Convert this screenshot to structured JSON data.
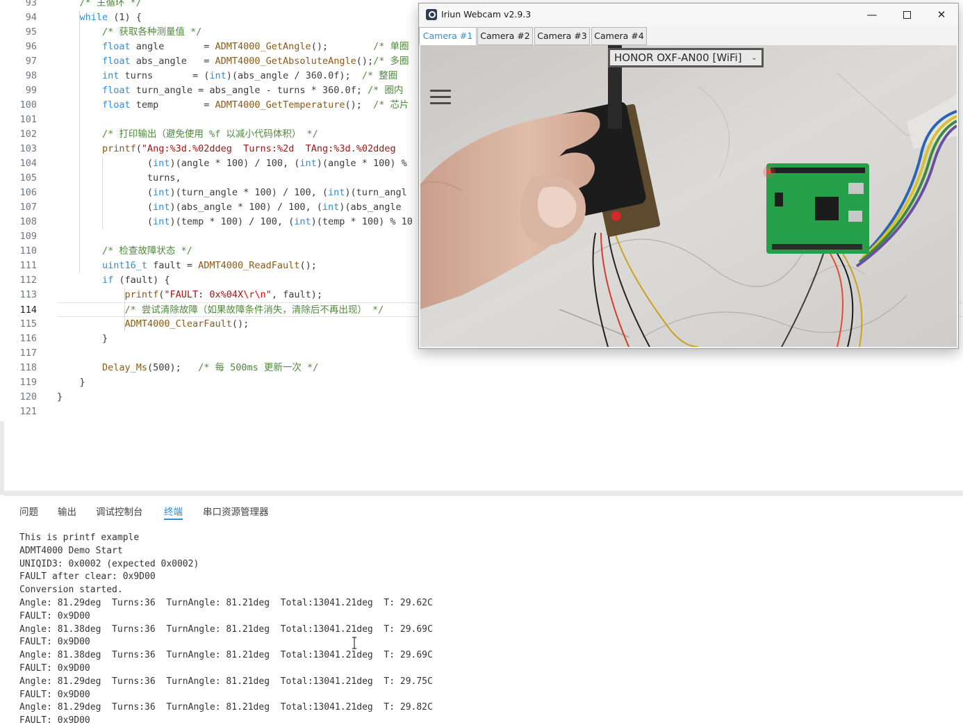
{
  "editor": {
    "lines": [
      {
        "n": "93",
        "indent": 4,
        "tokens": [
          [
            "cm",
            "/* 主循环 */"
          ]
        ]
      },
      {
        "n": "94",
        "indent": 4,
        "tokens": [
          [
            "kw",
            "while"
          ],
          [
            "pl",
            " (1) {"
          ]
        ]
      },
      {
        "n": "95",
        "indent": 8,
        "tokens": [
          [
            "cm",
            "/* 获取各种测量值 */"
          ]
        ]
      },
      {
        "n": "96",
        "indent": 8,
        "tokens": [
          [
            "type",
            "float"
          ],
          [
            "pl",
            " angle       = "
          ],
          [
            "fn",
            "ADMT4000_GetAngle"
          ],
          [
            "pl",
            "();        "
          ],
          [
            "cm",
            "/* 单圈"
          ]
        ]
      },
      {
        "n": "97",
        "indent": 8,
        "tokens": [
          [
            "type",
            "float"
          ],
          [
            "pl",
            " abs_angle   = "
          ],
          [
            "fn",
            "ADMT4000_GetAbsoluteAngle"
          ],
          [
            "pl",
            "();"
          ],
          [
            "cm",
            "/* 多圈"
          ]
        ]
      },
      {
        "n": "98",
        "indent": 8,
        "tokens": [
          [
            "type",
            "int"
          ],
          [
            "pl",
            " turns       = ("
          ],
          [
            "type",
            "int"
          ],
          [
            "pl",
            ")(abs_angle / 360.0f);  "
          ],
          [
            "cm",
            "/* 整圈"
          ]
        ]
      },
      {
        "n": "99",
        "indent": 8,
        "tokens": [
          [
            "type",
            "float"
          ],
          [
            "pl",
            " turn_angle = abs_angle - turns * 360.0f; "
          ],
          [
            "cm",
            "/* 圈内"
          ]
        ]
      },
      {
        "n": "100",
        "indent": 8,
        "tokens": [
          [
            "type",
            "float"
          ],
          [
            "pl",
            " temp        = "
          ],
          [
            "fn",
            "ADMT4000_GetTemperature"
          ],
          [
            "pl",
            "();  "
          ],
          [
            "cm",
            "/* 芯片"
          ]
        ]
      },
      {
        "n": "101",
        "indent": 0,
        "tokens": []
      },
      {
        "n": "102",
        "indent": 8,
        "tokens": [
          [
            "cm",
            "/* 打印输出（避免使用 %f 以减小代码体积） */"
          ]
        ]
      },
      {
        "n": "103",
        "indent": 8,
        "tokens": [
          [
            "fn",
            "printf"
          ],
          [
            "pl",
            "("
          ],
          [
            "str",
            "\"Ang:%3d.%02ddeg  Turns:%2d  TAng:%3d.%02ddeg"
          ]
        ]
      },
      {
        "n": "104",
        "indent": 16,
        "tokens": [
          [
            "pl",
            "("
          ],
          [
            "type",
            "int"
          ],
          [
            "pl",
            ")(angle * 100) / 100, ("
          ],
          [
            "type",
            "int"
          ],
          [
            "pl",
            ")(angle * 100) %"
          ]
        ]
      },
      {
        "n": "105",
        "indent": 16,
        "tokens": [
          [
            "pl",
            "turns,"
          ]
        ]
      },
      {
        "n": "106",
        "indent": 16,
        "tokens": [
          [
            "pl",
            "("
          ],
          [
            "type",
            "int"
          ],
          [
            "pl",
            ")(turn_angle * 100) / 100, ("
          ],
          [
            "type",
            "int"
          ],
          [
            "pl",
            ")(turn_angl"
          ]
        ]
      },
      {
        "n": "107",
        "indent": 16,
        "tokens": [
          [
            "pl",
            "("
          ],
          [
            "type",
            "int"
          ],
          [
            "pl",
            ")(abs_angle * 100) / 100, ("
          ],
          [
            "type",
            "int"
          ],
          [
            "pl",
            ")(abs_angle "
          ]
        ]
      },
      {
        "n": "108",
        "indent": 16,
        "tokens": [
          [
            "pl",
            "("
          ],
          [
            "type",
            "int"
          ],
          [
            "pl",
            ")(temp * 100) / 100, ("
          ],
          [
            "type",
            "int"
          ],
          [
            "pl",
            ")(temp * 100) % 10"
          ]
        ]
      },
      {
        "n": "109",
        "indent": 0,
        "tokens": []
      },
      {
        "n": "110",
        "indent": 8,
        "tokens": [
          [
            "cm",
            "/* 检查故障状态 */"
          ]
        ]
      },
      {
        "n": "111",
        "indent": 8,
        "tokens": [
          [
            "type",
            "uint16_t"
          ],
          [
            "pl",
            " fault = "
          ],
          [
            "fn",
            "ADMT4000_ReadFault"
          ],
          [
            "pl",
            "();"
          ]
        ]
      },
      {
        "n": "112",
        "indent": 8,
        "tokens": [
          [
            "kw",
            "if"
          ],
          [
            "pl",
            " (fault) {"
          ]
        ]
      },
      {
        "n": "113",
        "indent": 12,
        "tokens": [
          [
            "fn",
            "printf"
          ],
          [
            "pl",
            "("
          ],
          [
            "str",
            "\"FAULT: 0x%04X"
          ],
          [
            "esc",
            "\\r\\n"
          ],
          [
            "str",
            "\""
          ],
          [
            "pl",
            ", fault);"
          ]
        ]
      },
      {
        "n": "114",
        "indent": 12,
        "tokens": [
          [
            "cm",
            "/* 尝试清除故障（如果故障条件消失，清除后不再出现） */"
          ]
        ]
      },
      {
        "n": "115",
        "indent": 12,
        "tokens": [
          [
            "fn",
            "ADMT4000_ClearFault"
          ],
          [
            "pl",
            "();"
          ]
        ]
      },
      {
        "n": "116",
        "indent": 8,
        "tokens": [
          [
            "pl",
            "}"
          ]
        ]
      },
      {
        "n": "117",
        "indent": 0,
        "tokens": []
      },
      {
        "n": "118",
        "indent": 8,
        "tokens": [
          [
            "fn",
            "Delay_Ms"
          ],
          [
            "pl",
            "(500);   "
          ],
          [
            "cm",
            "/* 每 500ms 更新一次 */"
          ]
        ]
      },
      {
        "n": "119",
        "indent": 4,
        "tokens": [
          [
            "pl",
            "}"
          ]
        ]
      },
      {
        "n": "120",
        "indent": 0,
        "tokens": [
          [
            "pl",
            "}"
          ]
        ]
      },
      {
        "n": "121",
        "indent": 0,
        "tokens": []
      }
    ],
    "active_line": "114"
  },
  "webcam": {
    "title": "Iriun Webcam v2.9.3",
    "minimize": "—",
    "close": "✕",
    "tabs": [
      "Camera #1",
      "Camera #2",
      "Camera #3",
      "Camera #4"
    ],
    "active_tab": 0,
    "device": "HONOR OXF-AN00 [WiFi]",
    "device_chevron": "⌄"
  },
  "panel": {
    "tabs": [
      "问题",
      "输出",
      "调试控制台",
      "终端",
      "串口资源管理器"
    ],
    "active_tab": 3
  },
  "terminal": {
    "lines": [
      "This is printf example",
      "ADMT4000 Demo Start",
      "UNIQID3: 0x0002 (expected 0x0002)",
      "FAULT after clear: 0x9D00",
      "Conversion started.",
      "Angle: 81.29deg  Turns:36  TurnAngle: 81.21deg  Total:13041.21deg  T: 29.62C",
      "FAULT: 0x9D00",
      "Angle: 81.38deg  Turns:36  TurnAngle: 81.21deg  Total:13041.21deg  T: 29.69C",
      "FAULT: 0x9D00",
      "Angle: 81.38deg  Turns:36  TurnAngle: 81.21deg  Total:13041.21deg  T: 29.69C",
      "FAULT: 0x9D00",
      "Angle: 81.29deg  Turns:36  TurnAngle: 81.21deg  Total:13041.21deg  T: 29.75C",
      "FAULT: 0x9D00",
      "Angle: 81.29deg  Turns:36  TurnAngle: 81.21deg  Total:13041.21deg  T: 29.82C",
      "FAULT: 0x9D00"
    ]
  },
  "colors": {
    "keyword": "#2f8dd6",
    "comment": "#4f8a3b",
    "function": "#8a5a16",
    "string": "#a31515",
    "accent": "#2f8dd6"
  }
}
